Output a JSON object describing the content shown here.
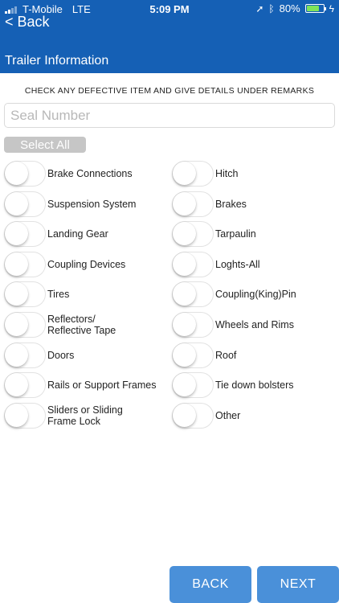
{
  "status_bar": {
    "carrier": "T-Mobile",
    "network": "LTE",
    "time": "5:09 PM",
    "battery": "80%",
    "battery_level": 0.8
  },
  "nav": {
    "back_label": "< Back",
    "title": "Trailer Information"
  },
  "form": {
    "instructions": "CHECK ANY DEFECTIVE ITEM AND GIVE DETAILS UNDER REMARKS",
    "seal_placeholder": "Seal Number",
    "select_all_label": "Select All"
  },
  "checklist": {
    "left": [
      {
        "label": "Brake Connections",
        "checked": false
      },
      {
        "label": "Suspension System",
        "checked": false
      },
      {
        "label": "Landing Gear",
        "checked": false
      },
      {
        "label": "Coupling Devices",
        "checked": false
      },
      {
        "label": "Tires",
        "checked": false
      },
      {
        "label": "Reflectors/ Reflective Tape",
        "checked": false
      },
      {
        "label": "Doors",
        "checked": false
      },
      {
        "label": "Rails or Support Frames",
        "checked": false
      },
      {
        "label": "Sliders or Sliding Frame Lock",
        "checked": false
      }
    ],
    "right": [
      {
        "label": "Hitch",
        "checked": false
      },
      {
        "label": "Brakes",
        "checked": false
      },
      {
        "label": "Tarpaulin",
        "checked": false
      },
      {
        "label": "Loghts-All",
        "checked": false
      },
      {
        "label": "Coupling(King)Pin",
        "checked": false
      },
      {
        "label": "Wheels and Rims",
        "checked": false
      },
      {
        "label": "Roof",
        "checked": false
      },
      {
        "label": "Tie down bolsters",
        "checked": false
      },
      {
        "label": "Other",
        "checked": false
      }
    ]
  },
  "footer": {
    "back_label": "BACK",
    "next_label": "NEXT"
  },
  "colors": {
    "header": "#1560b5",
    "button": "#4a90d9",
    "select_all": "#c6c6c6"
  }
}
